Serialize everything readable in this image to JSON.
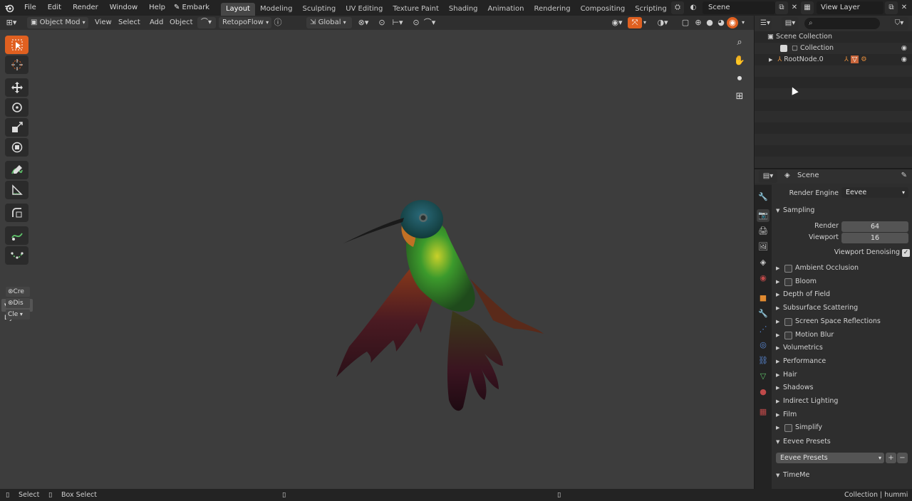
{
  "topbar": {
    "menus": [
      "File",
      "Edit",
      "Render",
      "Window",
      "Help"
    ],
    "embark_label": "Embark",
    "workspaces": [
      "Layout",
      "Modeling",
      "Sculpting",
      "UV Editing",
      "Texture Paint",
      "Shading",
      "Animation",
      "Rendering",
      "Compositing",
      "Scripting"
    ],
    "active_workspace": "Layout",
    "scene_name": "Scene",
    "view_layer": "View Layer"
  },
  "viewport_header": {
    "mode": "Object Mod",
    "view": "View",
    "select": "Select",
    "add": "Add",
    "object": "Object",
    "retopoflow": "RetopoFlow",
    "orientation": "Global"
  },
  "toolbar": {
    "dyn_panel": "Dynam",
    "dyn_buttons": [
      "Cre",
      "Dis",
      "Cle"
    ]
  },
  "outliner": {
    "scene_collection": "Scene Collection",
    "collection": "Collection",
    "root_node": "RootNode.0"
  },
  "properties": {
    "context": "Scene",
    "render_engine_label": "Render Engine",
    "render_engine": "Eevee",
    "sampling": {
      "title": "Sampling",
      "render_label": "Render",
      "render_value": "64",
      "viewport_label": "Viewport",
      "viewport_value": "16",
      "denoise_label": "Viewport Denoising"
    },
    "panels": [
      {
        "label": "Ambient Occlusion",
        "checkbox": true
      },
      {
        "label": "Bloom",
        "checkbox": true
      },
      {
        "label": "Depth of Field",
        "checkbox": false
      },
      {
        "label": "Subsurface Scattering",
        "checkbox": false
      },
      {
        "label": "Screen Space Reflections",
        "checkbox": true
      },
      {
        "label": "Motion Blur",
        "checkbox": true
      },
      {
        "label": "Volumetrics",
        "checkbox": false
      },
      {
        "label": "Performance",
        "checkbox": false
      },
      {
        "label": "Hair",
        "checkbox": false
      },
      {
        "label": "Shadows",
        "checkbox": false
      },
      {
        "label": "Indirect Lighting",
        "checkbox": false
      },
      {
        "label": "Film",
        "checkbox": false
      },
      {
        "label": "Simplify",
        "checkbox": true
      }
    ],
    "eevee_presets_title": "Eevee Presets",
    "eevee_presets_value": "Eevee Presets",
    "timeme_title": "TimeMe"
  },
  "statusbar": {
    "select": "Select",
    "box_select": "Box Select",
    "right": "Collection | hummi"
  },
  "colors": {
    "accent": "#e06020",
    "active_tab": "#474747",
    "background": "#3d3d3d"
  }
}
